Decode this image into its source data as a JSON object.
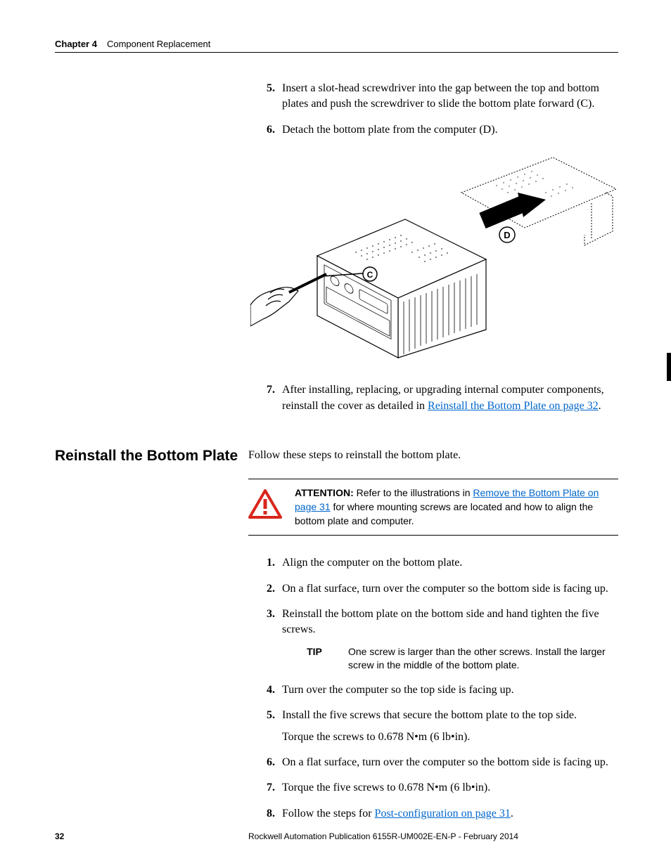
{
  "header": {
    "chapter_label": "Chapter 4",
    "section_label": "Component Replacement"
  },
  "top_steps": {
    "s5": {
      "num": "5.",
      "text": "Insert a slot-head screwdriver into the gap between the top and bottom plates and push the screwdriver to slide the bottom plate forward (C)."
    },
    "s6": {
      "num": "6.",
      "text": "Detach the bottom plate from the computer (D)."
    },
    "s7": {
      "num": "7.",
      "pre": "After installing, replacing, or upgrading internal computer components, reinstall the cover as detailed in ",
      "link": "Reinstall the Bottom Plate on page 32",
      "post": "."
    }
  },
  "figure": {
    "label_c": "C",
    "label_d": "D"
  },
  "section_title": "Reinstall the Bottom Plate",
  "intro_text": "Follow these steps to reinstall the bottom plate.",
  "attention": {
    "label": "ATTENTION:",
    "pre": " Refer to the illustrations in ",
    "link": "Remove the Bottom Plate on page 31",
    "post": " for where mounting screws are located and how to align the bottom plate and computer."
  },
  "bottom_steps": {
    "s1": {
      "num": "1.",
      "text": "Align the computer on the bottom plate."
    },
    "s2": {
      "num": "2.",
      "text": "On a flat surface, turn over the computer so the bottom side is facing up."
    },
    "s3": {
      "num": "3.",
      "text": "Reinstall the bottom plate on the bottom side and hand tighten the five screws."
    },
    "tip": {
      "label": "TIP",
      "text": "One screw is larger than the other screws. Install the larger screw in the middle of the bottom plate."
    },
    "s4": {
      "num": "4.",
      "text": "Turn over the computer so the top side is facing up."
    },
    "s5": {
      "num": "5.",
      "text": "Install the five screws that secure the bottom plate to the top side.",
      "torque": "Torque the screws to 0.678 N•m (6 lb•in)."
    },
    "s6": {
      "num": "6.",
      "text": "On a flat surface, turn over the computer so the bottom side is facing up."
    },
    "s7": {
      "num": "7.",
      "text": "Torque the five screws to 0.678 N•m (6 lb•in)."
    },
    "s8": {
      "num": "8.",
      "pre": "Follow the steps for ",
      "link": "Post-configuration on page 31",
      "post": "."
    }
  },
  "footer": {
    "page_number": "32",
    "publication": "Rockwell Automation Publication 6155R-UM002E-EN-P - February 2014"
  }
}
